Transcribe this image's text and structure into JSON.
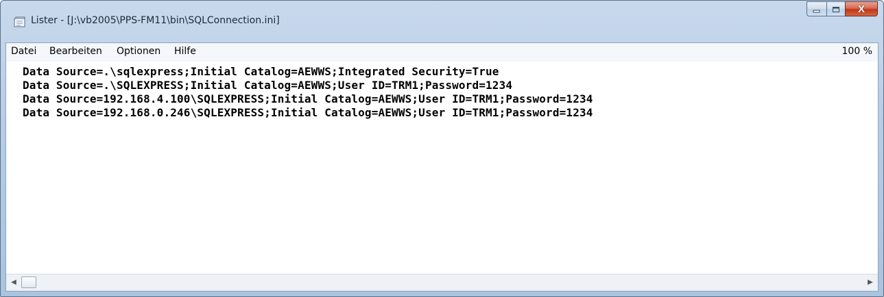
{
  "window": {
    "title": "Lister - [J:\\vb2005\\PPS-FM11\\bin\\SQLConnection.ini]",
    "icon": "lister-document-icon",
    "controls": {
      "minimize_icon": "minimize-icon",
      "maximize_icon": "maximize-icon",
      "close_glyph": "X"
    }
  },
  "menu": {
    "items": [
      {
        "label": "Datei"
      },
      {
        "label": "Bearbeiten"
      },
      {
        "label": "Optionen"
      },
      {
        "label": "Hilfe"
      }
    ],
    "zoom": "100 %"
  },
  "file": {
    "lines": [
      "Data Source=.\\sqlexpress;Initial Catalog=AEWWS;Integrated Security=True",
      "Data Source=.\\SQLEXPRESS;Initial Catalog=AEWWS;User ID=TRM1;Password=1234",
      "Data Source=192.168.4.100\\SQLEXPRESS;Initial Catalog=AEWWS;User ID=TRM1;Password=1234",
      "Data Source=192.168.0.246\\SQLEXPRESS;Initial Catalog=AEWWS;User ID=TRM1;Password=1234"
    ]
  },
  "scrollbar": {
    "left_arrow": "◀",
    "right_arrow": "▶"
  },
  "colors": {
    "titlebar": "#b7cde6",
    "close_button": "#c1361b",
    "text": "#000000"
  }
}
